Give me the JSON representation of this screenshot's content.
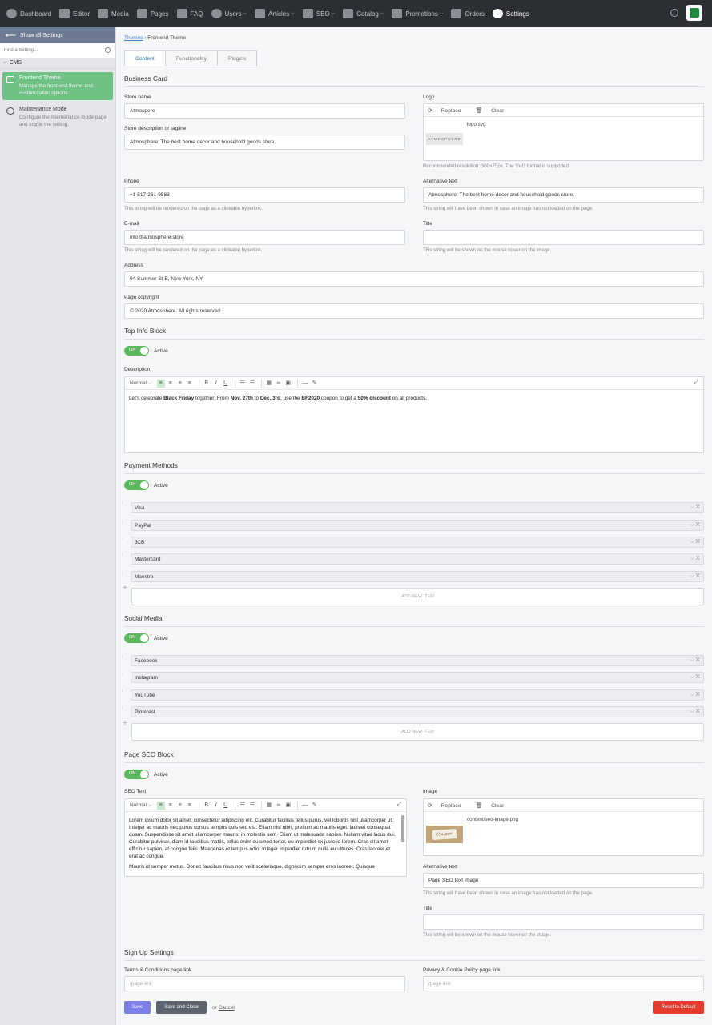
{
  "nav": {
    "items": [
      {
        "label": "Dashboard",
        "icon": "leaf-icon",
        "caret": ""
      },
      {
        "label": "Editor",
        "icon": "editor-icon",
        "caret": ""
      },
      {
        "label": "Media",
        "icon": "camera-icon",
        "caret": ""
      },
      {
        "label": "Pages",
        "icon": "pages-icon",
        "caret": ""
      },
      {
        "label": "FAQ",
        "icon": "chat-icon",
        "caret": ""
      },
      {
        "label": "Users",
        "icon": "users-icon",
        "caret": "⌵"
      },
      {
        "label": "Articles",
        "icon": "newspaper-icon",
        "caret": "⌵"
      },
      {
        "label": "SEO",
        "icon": "chart-line-icon",
        "caret": "⌵"
      },
      {
        "label": "Catalog",
        "icon": "grid-icon",
        "caret": "⌵"
      },
      {
        "label": "Promotions",
        "icon": "ticket-icon",
        "caret": "⌵"
      },
      {
        "label": "Orders",
        "icon": "cart-icon",
        "caret": ""
      },
      {
        "label": "Settings",
        "icon": "gear-icon",
        "caret": ""
      }
    ]
  },
  "sidebar": {
    "back_label": "Show all Settings",
    "search_placeholder": "Find a Setting...",
    "group": "CMS",
    "items": [
      {
        "title": "Frontend Theme",
        "desc": "Manage the front-end theme and customization options."
      },
      {
        "title": "Maintenance Mode",
        "desc": "Configure the maintenance mode page and toggle the setting."
      }
    ]
  },
  "breadcrumb": {
    "link": "Themes",
    "current": "› Frontend Theme"
  },
  "tabs": [
    "Content",
    "Functionality",
    "Plugins"
  ],
  "business_card": {
    "title": "Business Card",
    "store_name_label": "Store name",
    "store_name": "Atmospere",
    "store_desc_label": "Store description or tagline",
    "store_desc": "Atmosphere: The best home decor and household goods store.",
    "logo_label": "Logo",
    "replace": "Replace",
    "clear": "Clear",
    "logo_file": "logo.svg",
    "logo_text": "ATMOSPHERE",
    "logo_hint": "Recommended resolution: 300×75px. The SVG format is supported.",
    "phone_label": "Phone",
    "phone": "+1 517-261-9583",
    "phone_hint": "This string will be rendered on the page as a clickable hyperlink.",
    "alt_label": "Alternative text",
    "alt": "Atmosphere: The best home decor and household goods store.",
    "alt_hint": "This string will have been shown in case an image has not loaded on the page.",
    "email_label": "E-mail",
    "email": "info@atmosphere.store",
    "email_hint": "This string will be rendered on the page as a clickable hyperlink.",
    "title_label": "Title",
    "title_value": "",
    "title_hint": "This string will be shown on the mouse hover on the image.",
    "address_label": "Address",
    "address": "94 Summer St B, New York, NY",
    "copyright_label": "Page copyright",
    "copyright": "© 2020 Atmosphere. All rights reserved."
  },
  "top_info": {
    "title": "Top Info Block",
    "toggle_on": "ON",
    "active": "Active",
    "desc_label": "Description",
    "format": "Normal",
    "t1": "Let's celebrate ",
    "b1": "Black Friday",
    "t2": " together! From ",
    "b2": "Nov. 27th",
    "t3": " to ",
    "b3": "Dec. 3rd",
    "t4": ", use the ",
    "b4": "BF2020",
    "t5": " coupon to get a ",
    "b5": "50% discount",
    "t6": " on all products."
  },
  "payment": {
    "title": "Payment Methods",
    "toggle_on": "ON",
    "active": "Active",
    "items": [
      "Visa",
      "PayPal",
      "JCB",
      "Mastercard",
      "Maestro"
    ],
    "add": "ADD NEW ITEM"
  },
  "social": {
    "title": "Social Media",
    "toggle_on": "ON",
    "active": "Active",
    "items": [
      "Facebook",
      "Instagram",
      "YouTube",
      "Pinterest"
    ],
    "add": "ADD NEW ITEM"
  },
  "seo": {
    "title": "Page SEO Block",
    "toggle_on": "ON",
    "active": "Active",
    "text_label": "SEO Text",
    "format": "Normal",
    "p1": "Lorem ipsum dolor sit amet, consectetur adipiscing elit. Curabitur facilisis tellus purus, vel lobortis nisl ullamcorper ut. Integer ac mauris nec purus cursus tempus quis sed est. Etiam nisi nibh, pretium ac mauris eget, laoreet consequat quam. Suspendisse sit amet ullamcorper mauris, in molestie sem. Etiam ut malesuada sapien. Nullam vitae lacus dui. Curabitur pulvinar, diam id faucibus mattis, tellus enim euismod tortor, eu imperdiet ex justo id lorem. Cras sit amet efficitur sapien, at congue felis. Maecenas et tempus odio. Integer imperdiet rutrum nulla eu ultrices. Cras laoreet et erat ac congue.",
    "p2": "Mauris id semper metus. Donec faucibus risus non velit scelerisque, dignissim semper eros laoreet. Quisque",
    "image_label": "Image",
    "replace": "Replace",
    "clear": "Clear",
    "image_file": "content/seo-image.png",
    "image_caption": "Coupon",
    "alt_label": "Alternative text",
    "alt": "Page SEO text image",
    "alt_hint": "This string will have been shown in case an image has not loaded on the page.",
    "title_label": "Title",
    "title_value": "",
    "title_hint": "This string will be shown on the mouse hover on the image."
  },
  "signup": {
    "title": "Sign Up Settings",
    "terms_label": "Terms & Conditions page link",
    "terms_placeholder": "/page-link",
    "privacy_label": "Privacy & Cookie Policy page link",
    "privacy_placeholder": "/page-link"
  },
  "footer": {
    "save": "Save",
    "save_close": "Save and Close",
    "or": "or",
    "cancel": "Cancel",
    "reset": "Reset to Default"
  }
}
